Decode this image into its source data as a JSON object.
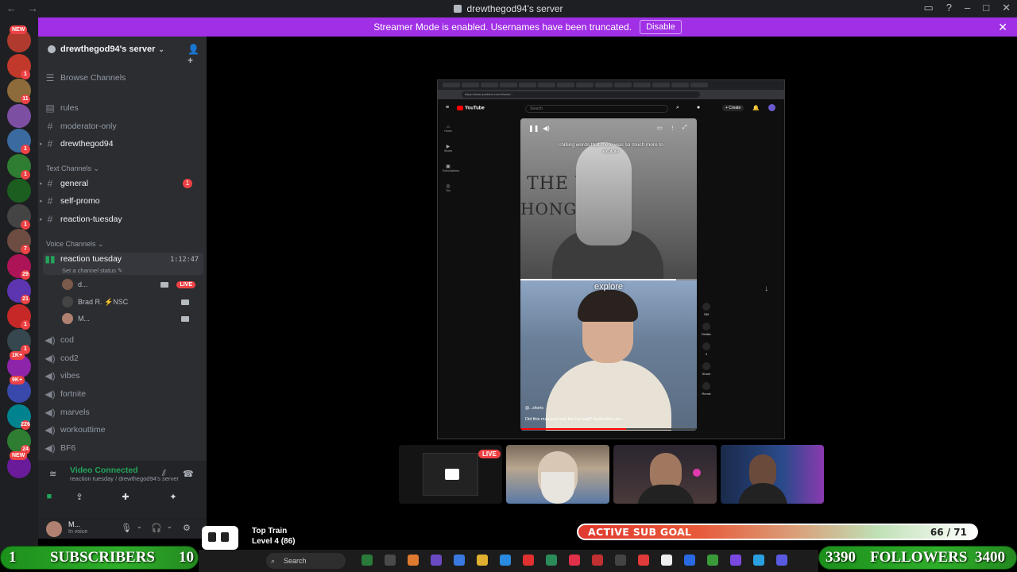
{
  "window": {
    "title": "drewthegod94's server"
  },
  "banner": {
    "text": "Streamer Mode is enabled. Usernames have been truncated.",
    "button": "Disable"
  },
  "rail": {
    "servers": [
      {
        "tag": "NEW",
        "color": "#b03a2e"
      },
      {
        "badge": "1",
        "color": "#c0392b"
      },
      {
        "badge": "11",
        "color": "#8e6b3a"
      },
      {
        "badge": "",
        "color": "#7d4fa3"
      },
      {
        "badge": "1",
        "color": "#3b6aa0"
      },
      {
        "badge": "1",
        "color": "#2e7d32"
      },
      {
        "badge": "",
        "color": "#1b5e20"
      },
      {
        "badge": "1",
        "color": "#444"
      },
      {
        "badge": "7",
        "color": "#6d4c41"
      },
      {
        "badge": "29",
        "color": "#ad1457"
      },
      {
        "badge": "21",
        "color": "#5e35b1"
      },
      {
        "badge": "1",
        "color": "#c62828"
      },
      {
        "badge": "1",
        "color": "#37474f"
      },
      {
        "tag": "1K+",
        "color": "#8e24aa"
      },
      {
        "tag": "9K+",
        "color": "#3949ab"
      },
      {
        "badge": "226",
        "color": "#00838f"
      },
      {
        "badge": "24",
        "color": "#2e7d32"
      },
      {
        "tag": "NEW",
        "color": "#6a1b9a"
      }
    ]
  },
  "sidebar": {
    "server_name": "drewthegod94's server",
    "browse": "Browse Channels",
    "top_channels": [
      "rules",
      "moderator-only",
      "drewthegod94"
    ],
    "text_category": "Text Channels",
    "text_channels": [
      {
        "name": "general",
        "unread": "1"
      },
      {
        "name": "self-promo",
        "unread": ""
      },
      {
        "name": "reaction-tuesday",
        "unread": ""
      }
    ],
    "voice_category": "Voice Channels",
    "active_voice": {
      "name": "reaction tuesday",
      "time": "1:12:47",
      "status": "Set a channel status"
    },
    "voice_users": [
      {
        "name": "d...",
        "live": "LIVE"
      },
      {
        "name": "Brad R. ⚡NSC",
        "live": ""
      },
      {
        "name": "M...",
        "live": ""
      }
    ],
    "voice_channels": [
      "cod",
      "cod2",
      "vibes",
      "fortnite",
      "marvels",
      "workouttime",
      "BF6"
    ]
  },
  "voice_connected": {
    "title": "Video Connected",
    "subtitle": "reaction tuesday / drewthegod94's server"
  },
  "user": {
    "name": "M...",
    "status": "In voice"
  },
  "stream": {
    "url": "https://www.youtube.com/shorts/...",
    "yt_brand": "YouTube",
    "search_placeholder": "Search",
    "create": "+ Create",
    "side_items": [
      "Home",
      "Shorts",
      "Subscriptions",
      "You"
    ],
    "caption": "chilling words that there was so much more to explore",
    "overlay_word": "explore",
    "newspaper_line1": "THE W",
    "newspaper_line2": "HONG",
    "channel": "@...shorts",
    "short_title": "Did this man just leak the Ice wall? Authorities are ...",
    "actions": [
      "286",
      "Dislike",
      "4",
      "Share",
      "Remix"
    ],
    "progress": 0.6
  },
  "tiles": {
    "live_label": "LIVE"
  },
  "overlays": {
    "subgoal_label": "ACTIVE SUB GOAL",
    "subgoal_count": "66 / 71",
    "subgoal_progress": 0.93,
    "subs_left": "1",
    "subs_label": "SUBSCRIBERS",
    "subs_right": "10",
    "followers_left": "3390",
    "followers_label": "FOLLOWERS",
    "followers_right": "3400",
    "top_train": "Top Train",
    "train_level": "Level 4 (86)"
  },
  "taskbar": {
    "search": "Search"
  }
}
